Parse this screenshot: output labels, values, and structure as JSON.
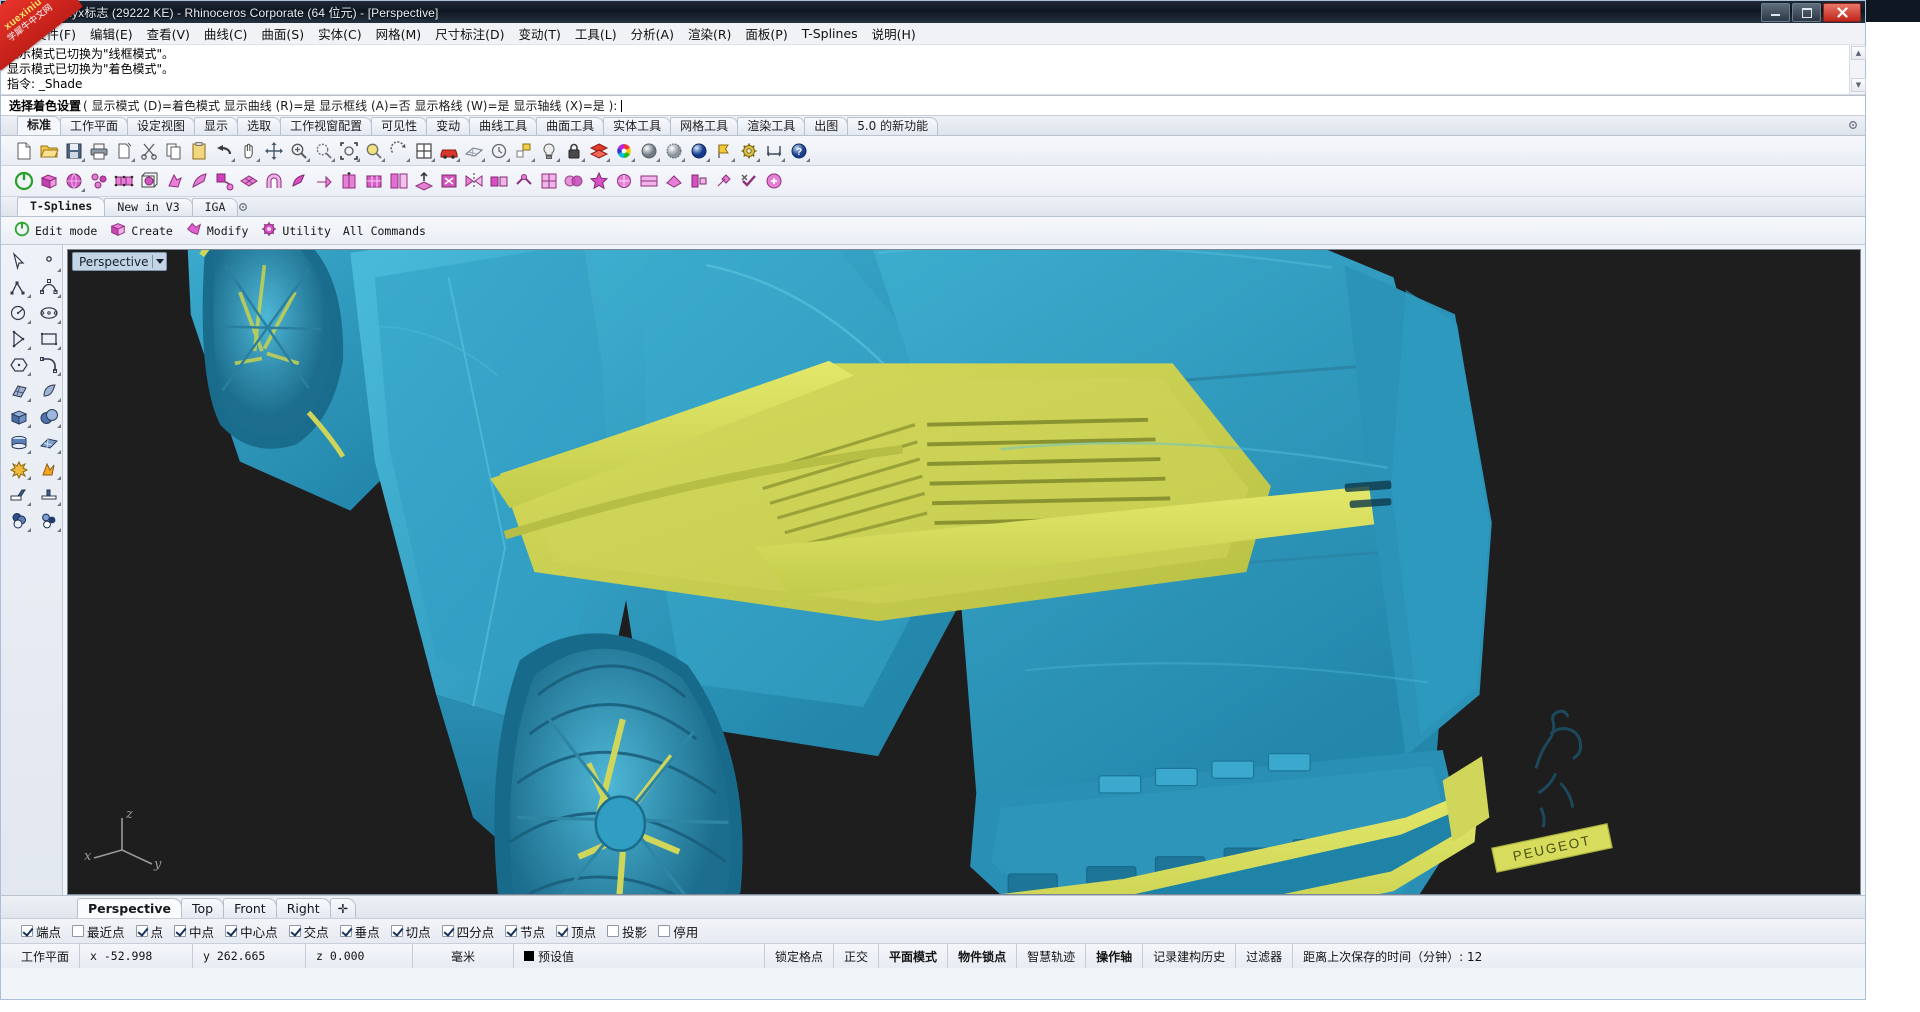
{
  "window": {
    "title": "Peugeot Onyx标志 (29222 KE) - Rhinoceros Corporate (64 位元) - [Perspective]",
    "minimize_label": "—",
    "maximize_label": "❐",
    "close_label": "✕"
  },
  "watermark": {
    "line1": "xuexiniu",
    "line2": "学犀牛中文网"
  },
  "menu": [
    {
      "label": "文件(F)"
    },
    {
      "label": "编辑(E)"
    },
    {
      "label": "查看(V)"
    },
    {
      "label": "曲线(C)"
    },
    {
      "label": "曲面(S)"
    },
    {
      "label": "实体(C)"
    },
    {
      "label": "网格(M)"
    },
    {
      "label": "尺寸标注(D)"
    },
    {
      "label": "变动(T)"
    },
    {
      "label": "工具(L)"
    },
    {
      "label": "分析(A)"
    },
    {
      "label": "渲染(R)"
    },
    {
      "label": "面板(P)"
    },
    {
      "label": "T-Splines"
    },
    {
      "label": "说明(H)"
    }
  ],
  "command_history": [
    "显示模式已切换为\"线框模式\"。",
    "显示模式已切换为\"着色模式\"。",
    "指令: _Shade"
  ],
  "command_prompt": {
    "label": "选择着色设置",
    "options": "( 显示模式 (D)=着色模式  显示曲线 (R)=是  显示框线 (A)=否  显示格线 (W)=是  显示轴线 (X)=是 ):"
  },
  "toolbar_tabs": [
    {
      "label": "标准",
      "active": true
    },
    {
      "label": "工作平面",
      "active": false
    },
    {
      "label": "设定视图",
      "active": false
    },
    {
      "label": "显示",
      "active": false
    },
    {
      "label": "选取",
      "active": false
    },
    {
      "label": "工作视窗配置",
      "active": false
    },
    {
      "label": "可见性",
      "active": false
    },
    {
      "label": "变动",
      "active": false
    },
    {
      "label": "曲线工具",
      "active": false
    },
    {
      "label": "曲面工具",
      "active": false
    },
    {
      "label": "实体工具",
      "active": false
    },
    {
      "label": "网格工具",
      "active": false
    },
    {
      "label": "渲染工具",
      "active": false
    },
    {
      "label": "出图",
      "active": false
    },
    {
      "label": "5.0 的新功能",
      "active": false
    }
  ],
  "standard_toolbar_icons": [
    "new-file-icon",
    "open-folder-icon",
    "save-icon",
    "print-icon",
    "copy-to-clipboard-icon",
    "cut-scissors-icon",
    "copy-icon",
    "paste-clipboard-icon",
    "undo-arrow-icon",
    "pan-hand-icon",
    "move-icon",
    "zoom-in-icon",
    "zoom-window-icon",
    "zoom-extents-icon",
    "zoom-selected-icon",
    "rotate-view-icon",
    "viewport-layout-icon",
    "car-render-icon",
    "plane-mesh-icon",
    "history-icon",
    "properties-icon",
    "light-bulb-icon",
    "lock-icon",
    "layer-icon",
    "color-wheel-icon",
    "shade-sphere-icon",
    "ghosted-sphere-icon",
    "render-sphere-icon",
    "flag-icon",
    "options-gear-icon",
    "dimension-icon",
    "help-icon"
  ],
  "tsplines_toolbar_icons": [
    "power-edit-mode-icon",
    "tsbox-icon",
    "tsphere-icon",
    "tsconvert-icon",
    "tsgrid-icon",
    "tsbox-wire-icon",
    "tspick-icon",
    "tsbend-icon",
    "tspull-icon",
    "tsthicken-icon",
    "tsbridge-icon",
    "tsweld-icon",
    "tsextrude-icon",
    "tscrease-icon",
    "tsgrid2-icon",
    "tsmatch-icon",
    "tsinsert-icon",
    "tsdelete-icon",
    "tssymmetry-icon",
    "tsmirror-icon",
    "tsunweld-icon",
    "tssubdivide-icon",
    "tsmerge-icon",
    "tsstar-icon",
    "tsrebuild-icon",
    "tsdisplay-icon",
    "tsmanipulate-icon",
    "tsalign-icon",
    "tstools-icon",
    "tscheck-icon",
    "tsexport-icon"
  ],
  "tsplines_panel": {
    "tabs": [
      {
        "label": "T-Splines",
        "active": true
      },
      {
        "label": "New in V3",
        "active": false
      },
      {
        "label": "IGA",
        "active": false
      }
    ],
    "commands": [
      {
        "label": "Edit mode",
        "icon": "power-icon"
      },
      {
        "label": "Create",
        "icon": "cube-icon"
      },
      {
        "label": "Modify",
        "icon": "modify-icon"
      },
      {
        "label": "Utility",
        "icon": "gear-icon"
      },
      {
        "label": "All Commands",
        "icon": ""
      }
    ]
  },
  "left_toolbar_icons": [
    "select-arrow-icon",
    "point-icon",
    "polyline-icon",
    "control-point-curve-icon",
    "arc-icon",
    "ellipse-icon",
    "curve-from-points-icon",
    "rectangle-icon",
    "polygon-icon",
    "fillet-curve-icon",
    "surface-from-points-icon",
    "revolve-surface-icon",
    "box-solid-icon",
    "boolean-union-icon",
    "cylinder-solid-icon",
    "mesh-plane-icon",
    "explode-icon",
    "split-icon",
    "trim-icon",
    "join-icon",
    "layers-icon",
    "group-icon"
  ],
  "viewport": {
    "label": "Perspective",
    "dropdown_icon": "chevron-down-icon",
    "background_color": "#1e1e1e",
    "axis": {
      "x": "x",
      "y": "y",
      "z": "z"
    },
    "model": {
      "name": "Peugeot Onyx concept car",
      "body_color": "#2e9dc0",
      "accent_color": "#c9cf4f",
      "badge_text": "PEUGEOT",
      "emblem": "peugeot-lion-icon"
    }
  },
  "view_tabs": [
    {
      "label": "Perspective",
      "active": true
    },
    {
      "label": "Top",
      "active": false
    },
    {
      "label": "Front",
      "active": false
    },
    {
      "label": "Right",
      "active": false
    },
    {
      "label": "✛",
      "active": false
    }
  ],
  "osnap": [
    {
      "label": "端点",
      "checked": true
    },
    {
      "label": "最近点",
      "checked": false
    },
    {
      "label": "点",
      "checked": true
    },
    {
      "label": "中点",
      "checked": true
    },
    {
      "label": "中心点",
      "checked": true
    },
    {
      "label": "交点",
      "checked": true
    },
    {
      "label": "垂点",
      "checked": true
    },
    {
      "label": "切点",
      "checked": true
    },
    {
      "label": "四分点",
      "checked": true
    },
    {
      "label": "节点",
      "checked": true
    },
    {
      "label": "顶点",
      "checked": true
    },
    {
      "label": "投影",
      "checked": false
    },
    {
      "label": "停用",
      "checked": false
    }
  ],
  "statusbar": {
    "cplane_label": "工作平面",
    "x_label": "x -52.998",
    "y_label": "y 262.665",
    "z_label": "z 0.000",
    "units": "毫米",
    "layer": "预设值",
    "layer_color": "#000000",
    "toggles": [
      {
        "label": "锁定格点",
        "bold": false
      },
      {
        "label": "正交",
        "bold": false
      },
      {
        "label": "平面模式",
        "bold": true
      },
      {
        "label": "物件锁点",
        "bold": true
      },
      {
        "label": "智慧轨迹",
        "bold": false
      },
      {
        "label": "操作轴",
        "bold": true
      },
      {
        "label": "记录建构历史",
        "bold": false
      },
      {
        "label": "过滤器",
        "bold": false
      }
    ],
    "autosave": "距离上次保存的时间（分钟）: 12"
  }
}
